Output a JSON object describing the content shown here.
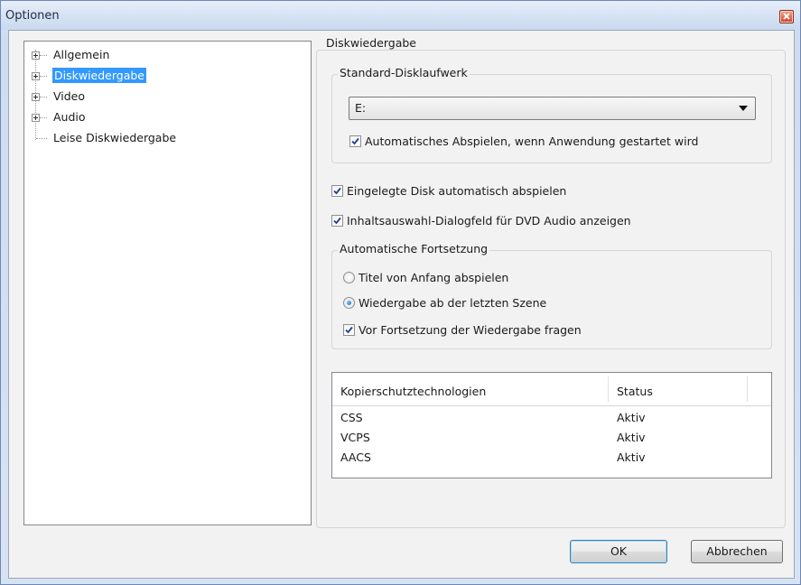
{
  "window": {
    "title": "Optionen"
  },
  "tree": {
    "items": [
      {
        "label": "Allgemein",
        "expandable": true,
        "selected": false
      },
      {
        "label": "Diskwiedergabe",
        "expandable": true,
        "selected": true
      },
      {
        "label": "Video",
        "expandable": true,
        "selected": false
      },
      {
        "label": "Audio",
        "expandable": true,
        "selected": false
      },
      {
        "label": "Leise Diskwiedergabe",
        "expandable": false,
        "selected": false
      }
    ]
  },
  "panel": {
    "title": "Diskwiedergabe",
    "drive_group": {
      "title": "Standard-Disklaufwerk",
      "drive_value": "E:",
      "autoplay_label": "Automatisches Abspielen, wenn Anwendung gestartet wird",
      "autoplay_checked": true
    },
    "auto_play_inserted": {
      "label": "Eingelegte Disk automatisch abspielen",
      "checked": true
    },
    "dvd_audio_dialog": {
      "label": "Inhaltsauswahl-Dialogfeld für DVD Audio anzeigen",
      "checked": true
    },
    "resume_group": {
      "title": "Automatische Fortsetzung",
      "radio_start": {
        "label": "Titel von Anfang abspielen",
        "selected": false
      },
      "radio_last_scene": {
        "label": "Wiedergabe ab der letzten Szene",
        "selected": true
      },
      "ask_before_resume": {
        "label": "Vor Fortsetzung der Wiedergabe fragen",
        "checked": true
      }
    },
    "copy_protection": {
      "columns": [
        "Kopierschutztechnologien",
        "Status"
      ],
      "rows": [
        [
          "CSS",
          "Aktiv"
        ],
        [
          "VCPS",
          "Aktiv"
        ],
        [
          "AACS",
          "Aktiv"
        ]
      ]
    }
  },
  "buttons": {
    "ok": "OK",
    "cancel": "Abbrechen"
  },
  "colors": {
    "selection": "#3399ff",
    "title_bar": "#c9d9ef",
    "window_border": "#6d88b3"
  },
  "icons": {
    "close": "close-icon",
    "checkmark": "checkmark-icon",
    "expand": "plus-expander-icon",
    "dropdown": "chevron-down-icon"
  }
}
